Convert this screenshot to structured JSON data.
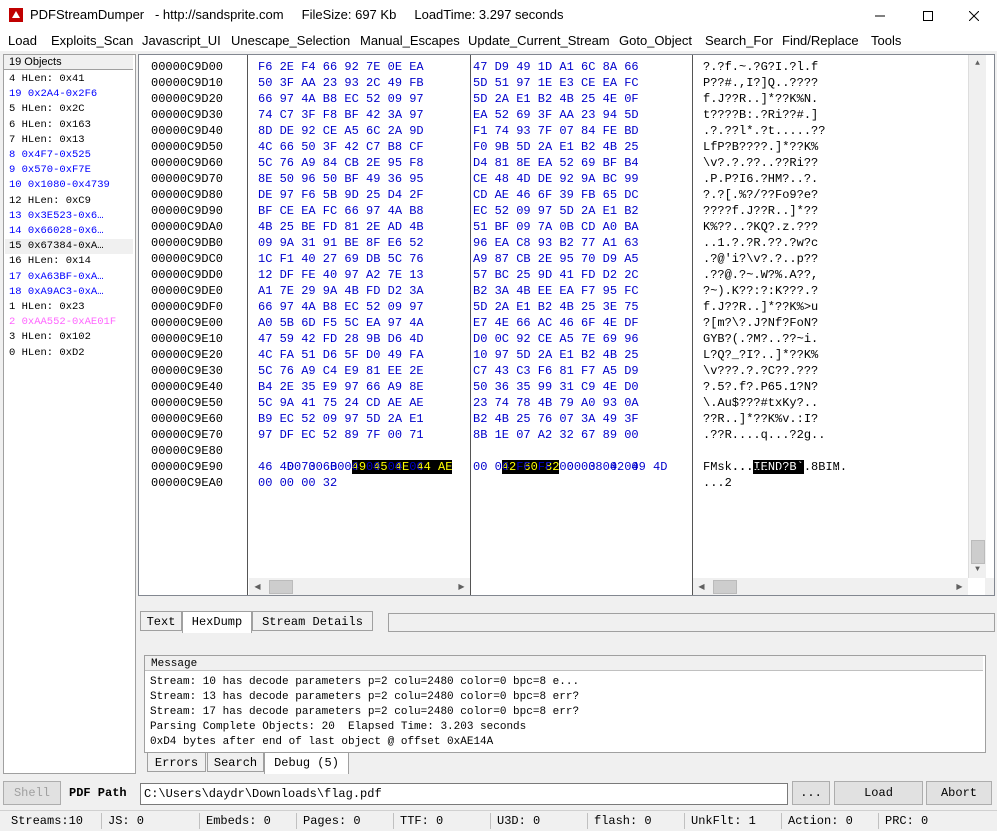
{
  "window": {
    "title": "PDFStreamDumper   - http://sandsprite.com     FileSize: 697 Kb     LoadTime: 3.297 seconds"
  },
  "menu": [
    "Load",
    "Exploits_Scan",
    "Javascript_UI",
    "Unescape_Selection",
    "Manual_Escapes",
    "Update_Current_Stream",
    "Goto_Object",
    "Search_For",
    "Find/Replace",
    "Tools"
  ],
  "objects": {
    "header": "19 Objects",
    "items": [
      {
        "text": "4 HLen: 0x41",
        "color": "#000000"
      },
      {
        "text": "19 0x2A4-0x2F6",
        "color": "#0000ff"
      },
      {
        "text": "5 HLen: 0x2C",
        "color": "#000000"
      },
      {
        "text": "6 HLen: 0x163",
        "color": "#000000"
      },
      {
        "text": "7 HLen: 0x13",
        "color": "#000000"
      },
      {
        "text": "8 0x4F7-0x525",
        "color": "#0000ff"
      },
      {
        "text": "9 0x570-0xF7E",
        "color": "#0000ff"
      },
      {
        "text": "10 0x1080-0x4739",
        "color": "#0000ff"
      },
      {
        "text": "12 HLen: 0xC9",
        "color": "#000000"
      },
      {
        "text": "13 0x3E523-0x6…",
        "color": "#0000ff"
      },
      {
        "text": "14 0x66028-0x6…",
        "color": "#0000ff"
      },
      {
        "text": "15 0x67384-0xA…",
        "color": "#000000"
      },
      {
        "text": "16 HLen: 0x14",
        "color": "#000000"
      },
      {
        "text": "17 0xA63BF-0xA…",
        "color": "#0000ff"
      },
      {
        "text": "18 0xA9AC3-0xA…",
        "color": "#0000ff"
      },
      {
        "text": "1 HLen: 0x23",
        "color": "#000000"
      },
      {
        "text": "2 0xAA552-0xAE01F",
        "color": "#ff66ff"
      },
      {
        "text": "3 HLen: 0x102",
        "color": "#000000"
      },
      {
        "text": "0 HLen: 0xD2",
        "color": "#000000"
      }
    ]
  },
  "hexdump": {
    "rows": [
      {
        "addr": "00000C9D00",
        "h1": "F6 2E F4 66 92 7E 0E EA",
        "h2": "47 D9 49 1D A1 6C 8A 66",
        "asc": "?.?f.~.?G?I.?l.f"
      },
      {
        "addr": "00000C9D10",
        "h1": "50 3F AA 23 93 2C 49 FB",
        "h2": "5D 51 97 1E E3 CE EA FC",
        "asc": "P??#.,I?]Q..????"
      },
      {
        "addr": "00000C9D20",
        "h1": "66 97 4A B8 EC 52 09 97",
        "h2": "5D 2A E1 B2 4B 25 4E 0F",
        "asc": "f.J??R..]*??K%N."
      },
      {
        "addr": "00000C9D30",
        "h1": "74 C7 3F F8 BF 42 3A 97",
        "h2": "EA 52 69 3F AA 23 94 5D",
        "asc": "t????B:.?Ri??#.]"
      },
      {
        "addr": "00000C9D40",
        "h1": "8D DE 92 CE A5 6C 2A 9D",
        "h2": "F1 74 93 7F 07 84 FE BD",
        "asc": ".?.??l*.?t.....??"
      },
      {
        "addr": "00000C9D50",
        "h1": "4C 66 50 3F 42 C7 B8 CF",
        "h2": "F0 9B 5D 2A E1 B2 4B 25",
        "asc": "LfP?B????.]*??K%"
      },
      {
        "addr": "00000C9D60",
        "h1": "5C 76 A9 84 CB 2E 95 F8",
        "h2": "D4 81 8E EA 52 69 BF B4",
        "asc": "\\v?.?.??..??Ri??"
      },
      {
        "addr": "00000C9D70",
        "h1": "8E 50 96 50 BF 49 36 95",
        "h2": "CE 48 4D DE 92 9A BC 99",
        "asc": ".P.P?I6.?HM?..?."
      },
      {
        "addr": "00000C9D80",
        "h1": "DE 97 F6 5B 9D 25 D4 2F",
        "h2": "CD AE 46 6F 39 FB 65 DC",
        "asc": "?.?[.%?/??Fo9?e?"
      },
      {
        "addr": "00000C9D90",
        "h1": "BF CE EA FC 66 97 4A B8",
        "h2": "EC 52 09 97 5D 2A E1 B2",
        "asc": "????f.J??R..]*??"
      },
      {
        "addr": "00000C9DA0",
        "h1": "4B 25 BE FD 81 2E AD 4B",
        "h2": "51 BF 09 7A 0B CD A0 BA",
        "asc": "K%??..?KQ?.z.???"
      },
      {
        "addr": "00000C9DB0",
        "h1": "09 9A 31 91 BE 8F E6 52",
        "h2": "96 EA C8 93 B2 77 A1 63",
        "asc": "..1.?.?R.??.?w?c"
      },
      {
        "addr": "00000C9DC0",
        "h1": "1C F1 40 27 69 DB 5C 76",
        "h2": "A9 87 CB 2E 95 70 D9 A5",
        "asc": ".?@'i?\\v?.?..p??"
      },
      {
        "addr": "00000C9DD0",
        "h1": "12 DF FE 40 97 A2 7E 13",
        "h2": "57 BC 25 9D 41 FD D2 2C",
        "asc": ".??@.?~.W?%.A??,"
      },
      {
        "addr": "00000C9DE0",
        "h1": "A1 7E 29 9A 4B FD D2 3A",
        "h2": "B2 3A 4B EE EA F7 95 FC",
        "asc": "?~).K??:?:K???.?"
      },
      {
        "addr": "00000C9DF0",
        "h1": "66 97 4A B8 EC 52 09 97",
        "h2": "5D 2A E1 B2 4B 25 3E 75",
        "asc": "f.J??R..]*??K%>u"
      },
      {
        "addr": "00000C9E00",
        "h1": "A0 5B 6D F5 5C EA 97 4A",
        "h2": "E7 4E 66 AC 46 6F 4E DF",
        "asc": "?[m?\\?.J?Nf?FoN?"
      },
      {
        "addr": "00000C9E10",
        "h1": "47 59 42 FD 28 9B D6 4D",
        "h2": "D0 0C 92 CE A5 7E 69 96",
        "asc": "GYB?(.?M?..??~i."
      },
      {
        "addr": "00000C9E20",
        "h1": "4C FA 51 D6 5F D0 49 FA",
        "h2": "10 97 5D 2A E1 B2 4B 25",
        "asc": "L?Q?_?I?..]*??K%"
      },
      {
        "addr": "00000C9E30",
        "h1": "5C 76 A9 C4 E9 81 EE 2E",
        "h2": "C7 43 C3 F6 81 F7 A5 D9",
        "asc": "\\v???.?.?C??.???"
      },
      {
        "addr": "00000C9E40",
        "h1": "B4 2E 35 E9 97 66 A9 8E",
        "h2": "50 36 35 99 31 C9 4E D0",
        "asc": "?.5?.f?.P65.1?N?"
      },
      {
        "addr": "00000C9E50",
        "h1": "5C 9A 41 75 24 CD AE AE",
        "h2": "23 74 78 4B 79 A0 93 0A",
        "asc": "\\.Au$???#txKy?.."
      },
      {
        "addr": "00000C9E60",
        "h1": "B9 EC 52 09 97 5D 2A E1",
        "h2": "B2 4B 25 76 07 3A 49 3F",
        "asc": "??R..]*??K%v.:I?"
      },
      {
        "addr": "00000C9E70",
        "h1": "97 DF EC 52 89 7F 00 71",
        "h2": "8B 1E 07 A2 32 67 89 00",
        "asc": ".??R....q...?2g.."
      }
    ],
    "row_e80": {
      "addr": "00000C9E80",
      "h1_plain": "00 00 00 ",
      "h1_hl": "49 45 4E 44 AE",
      "h2_hl": "42 60 82",
      "h2_plain": " 00 38 42 49 4D",
      "asc_plain1": "...",
      "asc_hl": "IEND?B`",
      "asc_plain2": ".8BIM"
    },
    "row_e90": {
      "addr": "00000C9E90",
      "h1": "46 4D 73 6B 00 00 00 0C",
      "h2": "00 00 FF FF 00 00 00 00",
      "asc": "FMsk.......      ..."
    },
    "row_ea0": {
      "addr": "00000C9EA0",
      "h1": "00 00 00 32",
      "h2": "",
      "asc": "...2"
    }
  },
  "tabs_top": [
    "Text",
    "HexDump",
    "Stream Details"
  ],
  "message": {
    "header": "Message",
    "lines": [
      "Stream: 10 has decode parameters p=2 colu=2480 color=0 bpc=8 e...",
      "Stream: 13 has decode parameters p=2 colu=2480 color=0 bpc=8 err?",
      "Stream: 17 has decode parameters p=2 colu=2480 color=0 bpc=8 err?",
      "Parsing Complete Objects: 20  Elapsed Time: 3.203 seconds",
      "0xD4 bytes after end of last object @ offset 0xAE14A"
    ]
  },
  "tabs_bottom": [
    "Errors",
    "Search",
    "Debug (5)"
  ],
  "bottom": {
    "shell": "Shell",
    "path_label": "PDF Path",
    "path_value": "C:\\Users\\daydr\\Downloads\\flag.pdf",
    "browse": "...",
    "load": "Load",
    "abort": "Abort"
  },
  "status": [
    "Streams:10",
    "JS: 0",
    "Embeds: 0",
    "Pages: 0",
    "TTF: 0",
    "U3D: 0",
    "flash: 0",
    "UnkFlt: 1",
    "Action: 0",
    "PRC: 0"
  ]
}
